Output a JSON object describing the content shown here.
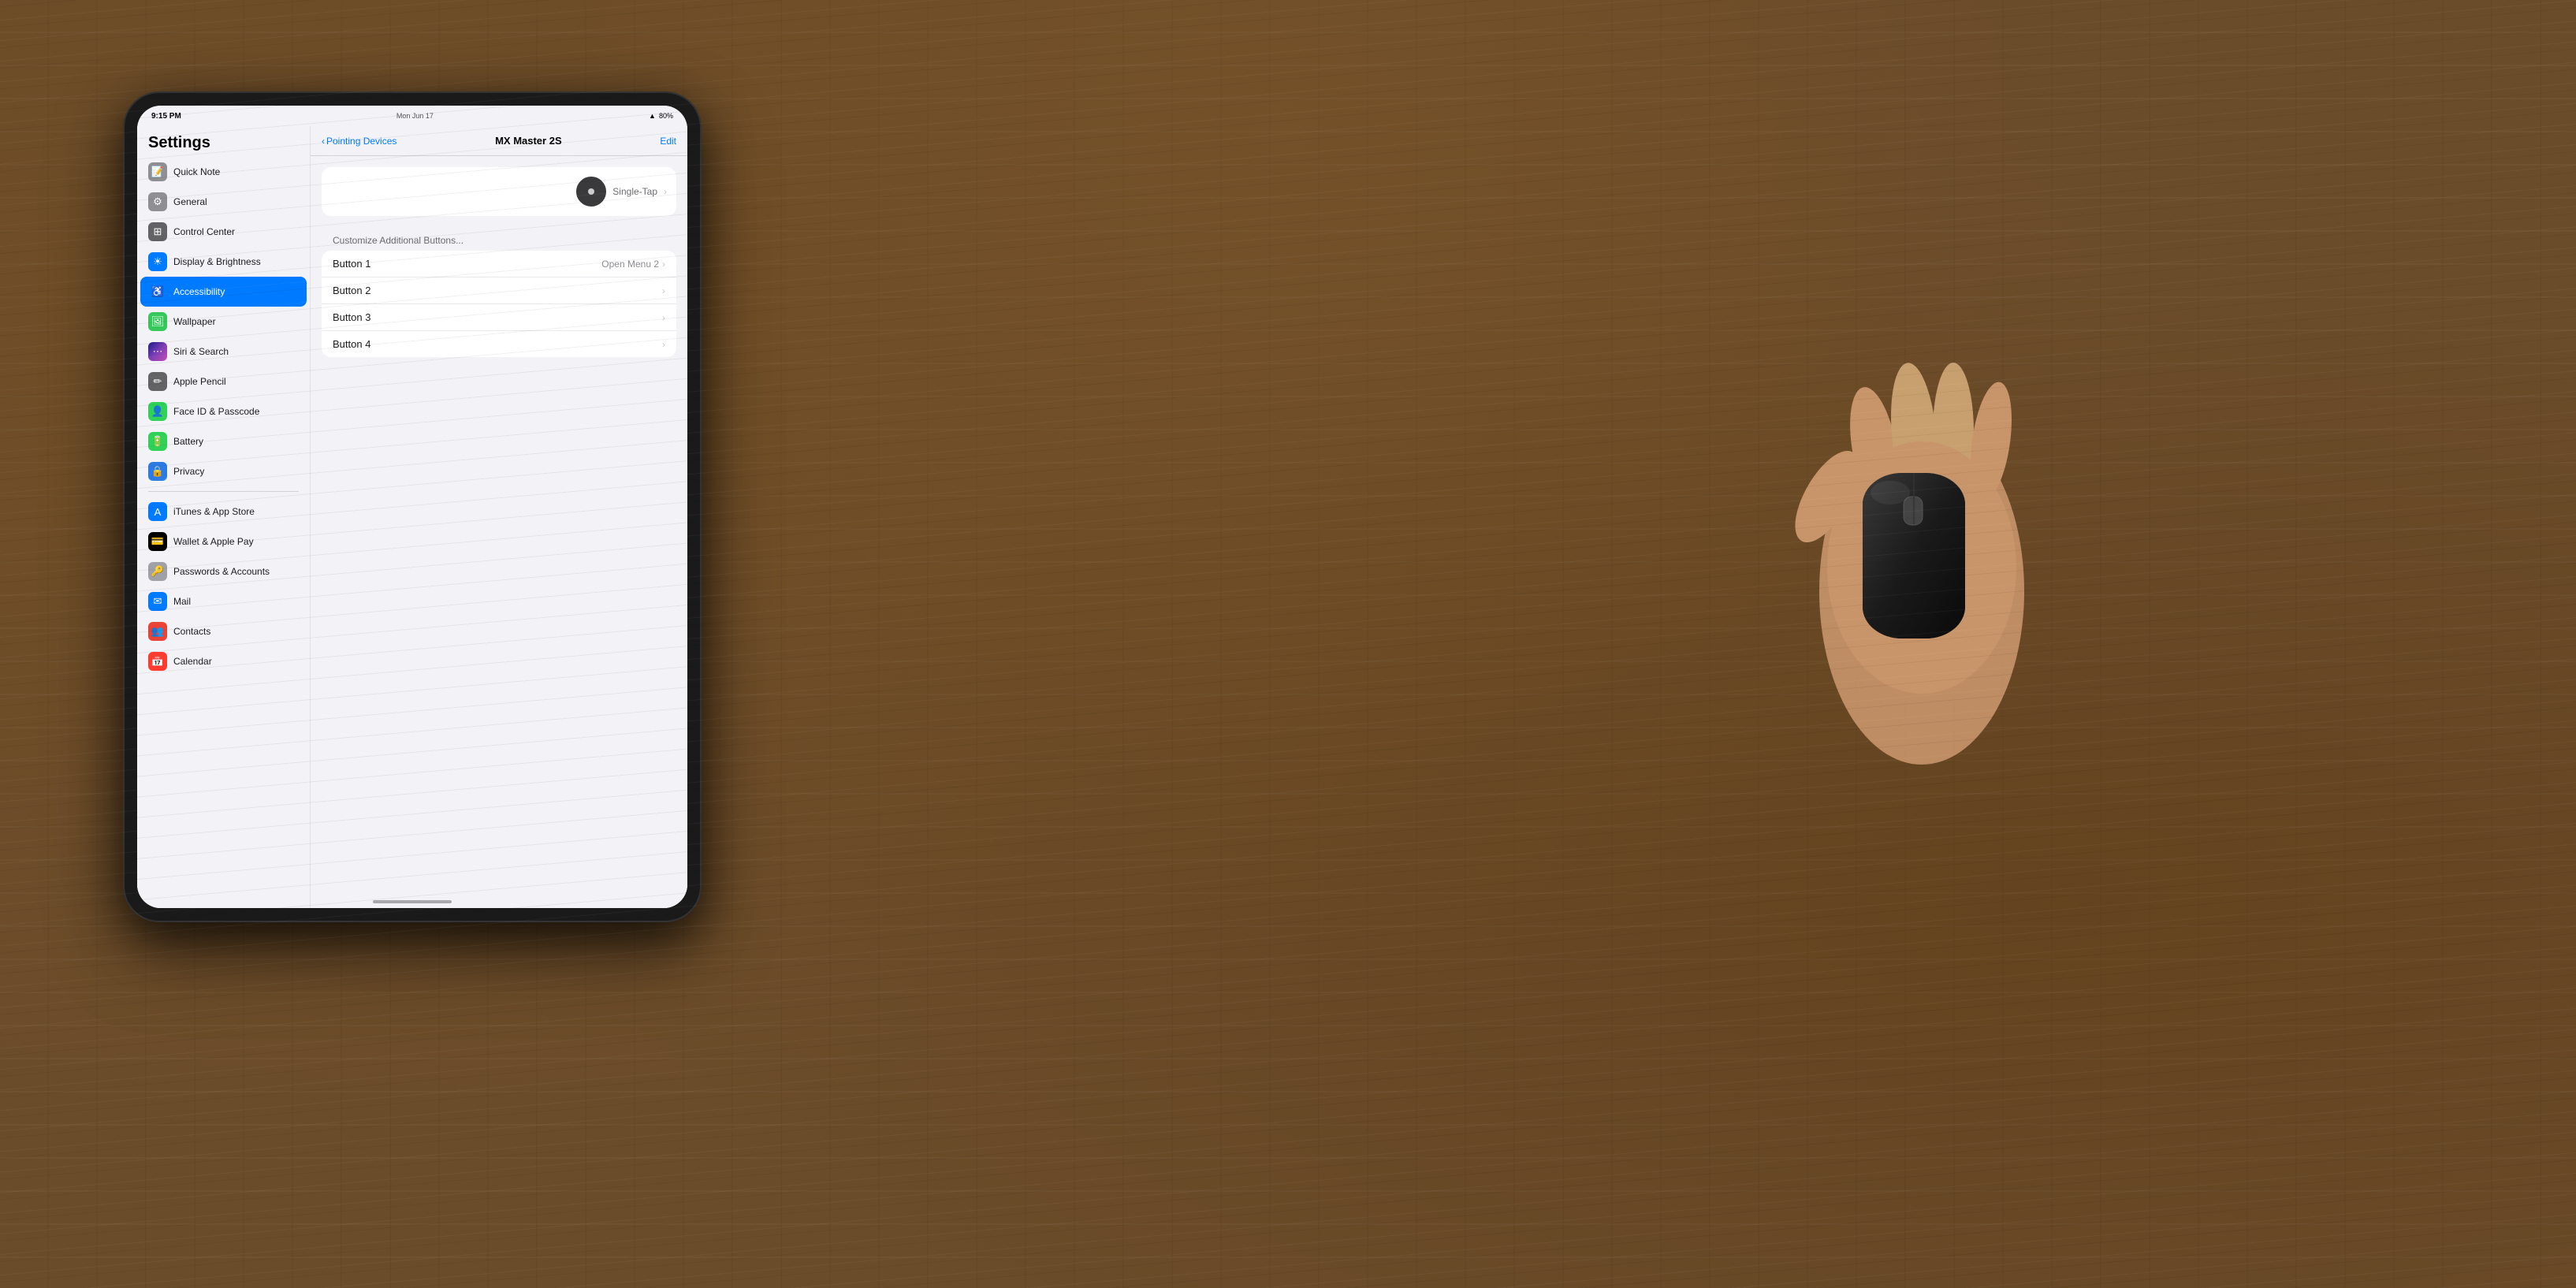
{
  "statusBar": {
    "time": "9:15 PM",
    "date": "Mon Jun 17",
    "wifi": "WiFi",
    "battery": "80%"
  },
  "sidebar": {
    "title": "Settings",
    "items": [
      {
        "id": "quick-note",
        "label": "Quick Note",
        "icon": "📝",
        "iconClass": "icon-general",
        "active": false
      },
      {
        "id": "general",
        "label": "General",
        "icon": "⚙",
        "iconClass": "icon-general",
        "active": false
      },
      {
        "id": "control-center",
        "label": "Control Center",
        "icon": "⊞",
        "iconClass": "icon-control",
        "active": false
      },
      {
        "id": "display",
        "label": "Display & Brightness",
        "icon": "☀",
        "iconClass": "icon-display",
        "active": false
      },
      {
        "id": "accessibility",
        "label": "Accessibility",
        "icon": "♿",
        "iconClass": "icon-accessibility",
        "active": true
      },
      {
        "id": "wallpaper",
        "label": "Wallpaper",
        "icon": "🖼",
        "iconClass": "icon-wallpaper",
        "active": false
      },
      {
        "id": "siri",
        "label": "Siri & Search",
        "icon": "⋯",
        "iconClass": "icon-siri",
        "active": false
      },
      {
        "id": "pencil",
        "label": "Apple Pencil",
        "icon": "✏",
        "iconClass": "icon-pencil",
        "active": false
      },
      {
        "id": "faceid",
        "label": "Face ID & Passcode",
        "icon": "👤",
        "iconClass": "icon-faceid",
        "active": false
      },
      {
        "id": "battery",
        "label": "Battery",
        "icon": "🔋",
        "iconClass": "icon-battery",
        "active": false
      },
      {
        "id": "privacy",
        "label": "Privacy",
        "icon": "🔒",
        "iconClass": "icon-privacy",
        "active": false
      },
      {
        "id": "itunes",
        "label": "iTunes & App Store",
        "icon": "A",
        "iconClass": "icon-itunes",
        "active": false
      },
      {
        "id": "wallet",
        "label": "Wallet & Apple Pay",
        "icon": "💳",
        "iconClass": "icon-wallet",
        "active": false
      },
      {
        "id": "passwords",
        "label": "Passwords & Accounts",
        "icon": "🔑",
        "iconClass": "icon-passwords",
        "active": false
      },
      {
        "id": "mail",
        "label": "Mail",
        "icon": "✉",
        "iconClass": "icon-mail",
        "active": false
      },
      {
        "id": "contacts",
        "label": "Contacts",
        "icon": "👥",
        "iconClass": "icon-contacts",
        "active": false
      },
      {
        "id": "calendar",
        "label": "Calendar",
        "icon": "📅",
        "iconClass": "icon-calendar",
        "active": false
      }
    ]
  },
  "navBar": {
    "backLabel": "Pointing Devices",
    "title": "MX Master 2S",
    "editLabel": "Edit"
  },
  "content": {
    "customizeLabel": "Customize Additional Buttons...",
    "buttons": [
      {
        "id": "button1",
        "label": "Button 1",
        "value": "Open Menu 2"
      },
      {
        "id": "button2",
        "label": "Button 2",
        "value": ""
      },
      {
        "id": "button3",
        "label": "Button 3",
        "value": ""
      },
      {
        "id": "button4",
        "label": "Button 4",
        "value": ""
      }
    ],
    "scrollLabel": "Single-Tap"
  }
}
